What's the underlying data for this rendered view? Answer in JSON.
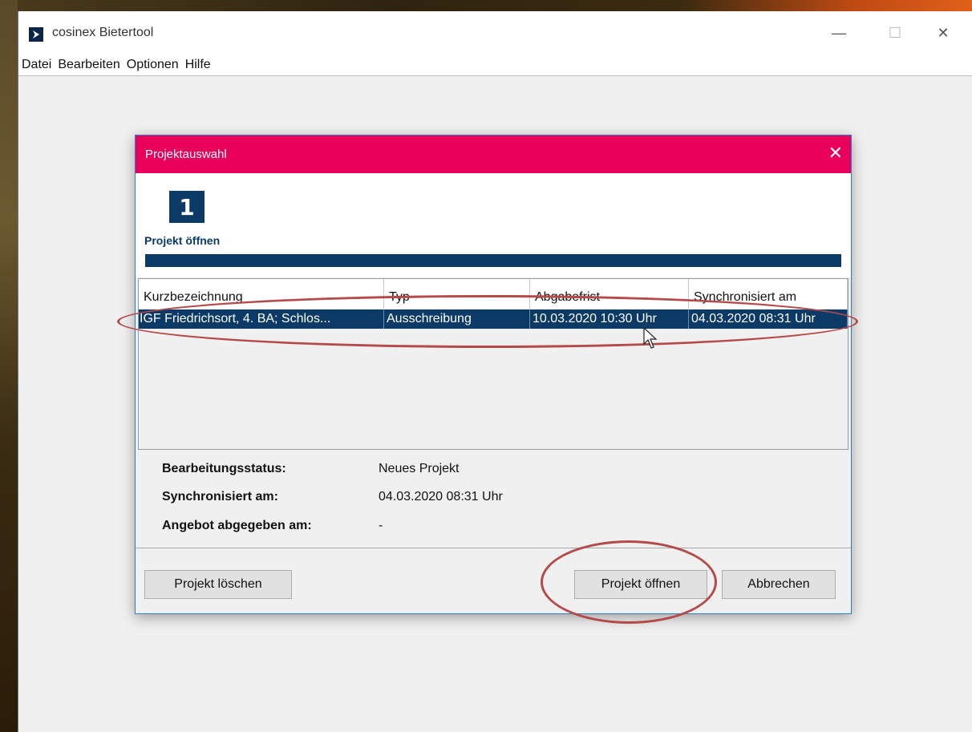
{
  "window": {
    "title": "cosinex Bietertool",
    "controls": {
      "minimize": "—",
      "maximize": "☐",
      "close": "✕"
    }
  },
  "menu": {
    "items": [
      "Datei",
      "Bearbeiten",
      "Optionen",
      "Hilfe"
    ]
  },
  "dialog": {
    "title": "Projektauswahl",
    "close": "✕",
    "step_number": "1",
    "step_label": "Projekt öffnen",
    "table": {
      "headers": [
        "Kurzbezeichnung",
        "Typ",
        "Abgabefrist",
        "Synchronisiert am"
      ],
      "rows": [
        [
          "IGF Friedrichsort, 4. BA; Schlos...",
          "Ausschreibung",
          "10.03.2020 10:30 Uhr",
          "04.03.2020 08:31 Uhr"
        ]
      ]
    },
    "details": [
      {
        "label": "Bearbeitungsstatus:",
        "value": "Neues Projekt"
      },
      {
        "label": "Synchronisiert am:",
        "value": "04.03.2020 08:31 Uhr"
      },
      {
        "label": "Angebot abgegeben am:",
        "value": "-"
      }
    ],
    "buttons": {
      "delete": "Projekt löschen",
      "open": "Projekt öffnen",
      "cancel": "Abbrechen"
    }
  },
  "colors": {
    "dialog_title_bg": "#e8005a",
    "accent_navy": "#0b3a66",
    "annotation": "#b44a4a"
  }
}
